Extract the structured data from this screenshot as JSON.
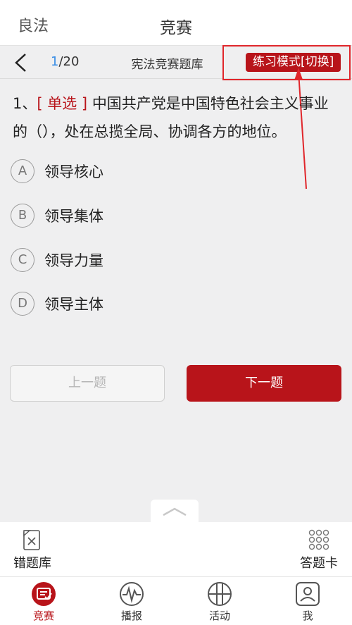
{
  "header": {
    "left_label": "良法",
    "title": "竞赛"
  },
  "quiz": {
    "current": "1",
    "total": "/20",
    "bank_name": "宪法竞赛题库",
    "mode_label": "练习模式[切换]",
    "question_number": "1、",
    "question_type": "[ 单选 ]",
    "question_line1": "中国共产党是中国特色社会主义事业",
    "question_line2": "的（），处在总揽全局、协调各方的地位。",
    "options": [
      {
        "letter": "A",
        "text": "领导核心"
      },
      {
        "letter": "B",
        "text": "领导集体"
      },
      {
        "letter": "C",
        "text": "领导力量"
      },
      {
        "letter": "D",
        "text": "领导主体"
      }
    ],
    "prev_label": "上一题",
    "next_label": "下一题"
  },
  "toolbar": {
    "wrong_bank_label": "错题库",
    "answer_card_label": "答题卡"
  },
  "nav": {
    "items": [
      {
        "label": "竞赛",
        "icon": "contest-icon"
      },
      {
        "label": "播报",
        "icon": "broadcast-icon"
      },
      {
        "label": "活动",
        "icon": "activity-icon"
      },
      {
        "label": "我",
        "icon": "profile-icon"
      }
    ],
    "active": "竞赛"
  },
  "colors": {
    "accent": "#b8141a",
    "highlight": "#e0262b",
    "counter": "#3a8ee6"
  }
}
